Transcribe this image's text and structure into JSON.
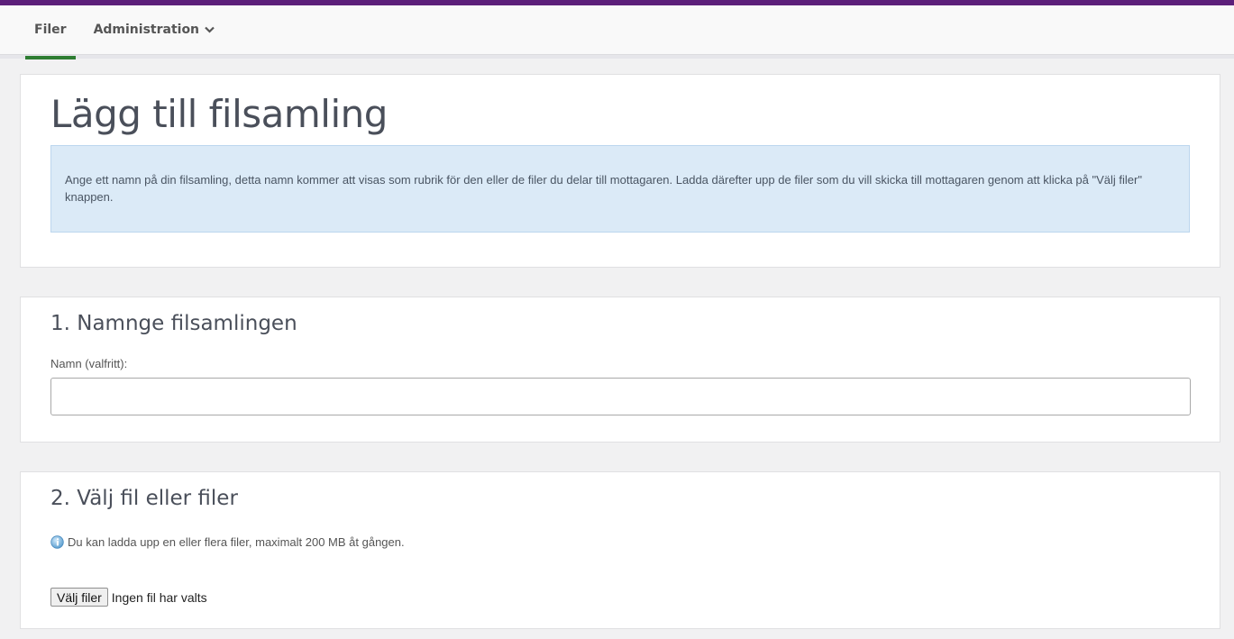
{
  "nav": {
    "items": [
      {
        "label": "Filer",
        "active": true
      },
      {
        "label": "Administration",
        "active": false,
        "has_dropdown": true
      }
    ]
  },
  "header": {
    "title": "Lägg till filsamling",
    "info_text": "Ange ett namn på din filsamling, detta namn kommer att visas som rubrik för den eller de filer du delar till mottagaren. Ladda därefter upp de filer som du vill skicka till mottagaren genom att klicka på \"Välj filer\" knappen."
  },
  "section1": {
    "title": "1. Namnge filsamlingen",
    "name_label": "Namn (valfritt):",
    "name_value": ""
  },
  "section2": {
    "title": "2. Välj fil eller filer",
    "hint": "Du kan ladda upp en eller flera filer, maximalt 200 MB åt gången.",
    "choose_button": "Välj filer",
    "no_file_text": "Ingen fil har valts"
  },
  "colors": {
    "topbar": "#5c1f7a",
    "active_tab": "#2e7d32",
    "info_bg": "#dbeaf7"
  }
}
